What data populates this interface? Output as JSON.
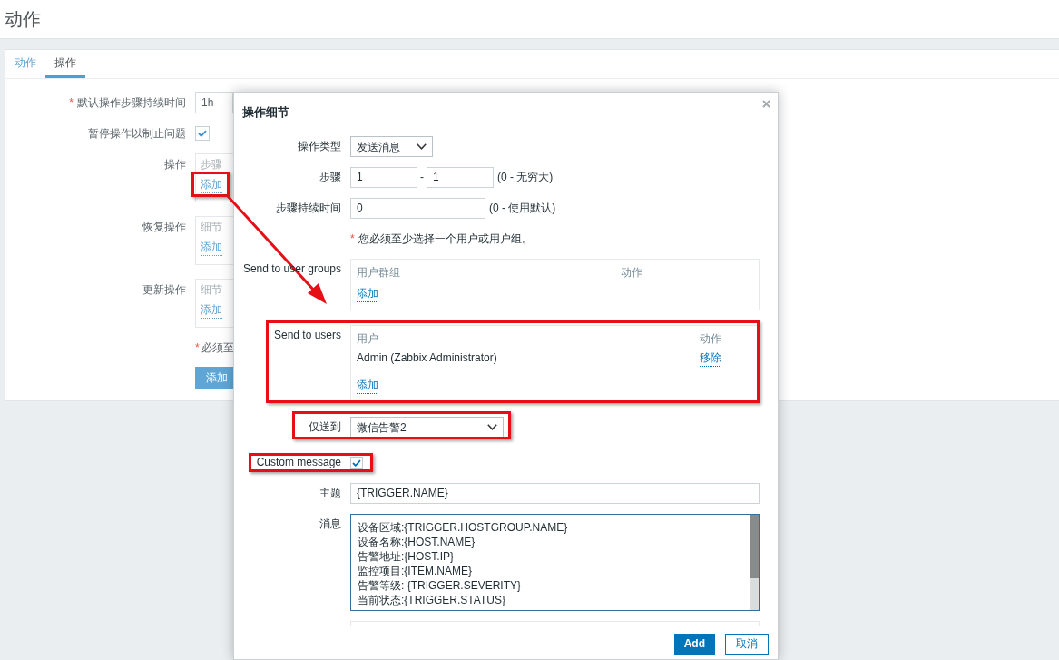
{
  "header": {
    "title": "动作"
  },
  "tabs": [
    {
      "label": "动作",
      "selected": false
    },
    {
      "label": "操作",
      "selected": true
    }
  ],
  "form": {
    "rows": [
      {
        "kind": "input",
        "mark": "*",
        "label": "默认操作步骤持续时间",
        "value": "1h",
        "highlighted": false
      },
      {
        "kind": "checkbox",
        "label": "暂停操作以制止问题",
        "checked": true,
        "highlighted": false
      },
      {
        "kind": "table",
        "label": "操作",
        "column": "步骤",
        "link": "添加",
        "highlighted": true
      },
      {
        "kind": "table",
        "label": "恢复操作",
        "column": "细节",
        "link": "添加",
        "highlighted": false
      },
      {
        "kind": "table",
        "label": "更新操作",
        "column": "细节",
        "link": "添加",
        "highlighted": false
      }
    ],
    "note": {
      "mark": "*",
      "text": "必须至"
    },
    "button": "添加"
  },
  "dialog": {
    "title": "操作细节",
    "fields": [
      {
        "kind": "select",
        "label": "操作类型",
        "value": "发送消息",
        "highlighted": false
      },
      {
        "kind": "range",
        "label": "步骤",
        "from": "1",
        "separator": "-",
        "to": "1",
        "hint": "(0 - 无穷大)",
        "highlighted": false
      },
      {
        "kind": "input",
        "label": "步骤持续时间",
        "value": "0",
        "hint": "(0 - 使用默认)",
        "highlighted": false
      },
      {
        "kind": "note",
        "mark": "*",
        "text": "您必须至少选择一个用户或用户组。",
        "highlighted": false
      },
      {
        "kind": "table",
        "label": "Send to user groups",
        "columns": [
          "用户群组",
          "动作"
        ],
        "link": "添加",
        "highlighted": false
      },
      {
        "kind": "table",
        "label": "Send to users",
        "columns": [
          "用户",
          "动作"
        ],
        "rows": [
          {
            "name": "Admin (Zabbix Administrator)",
            "action": "移除"
          }
        ],
        "link": "添加",
        "highlighted": true
      },
      {
        "kind": "select",
        "label": "仅送到",
        "value": "微信告警2",
        "highlighted": true
      },
      {
        "kind": "checkbox",
        "label": "Custom message",
        "checked": true,
        "highlighted": true
      },
      {
        "kind": "input",
        "label": "主题",
        "value": "{TRIGGER.NAME}",
        "highlighted": false
      },
      {
        "kind": "textarea",
        "label": "消息",
        "lines": [
          "设备区域:{TRIGGER.HOSTGROUP.NAME}",
          "设备名称:{HOST.NAME}",
          "告警地址:{HOST.IP}",
          "监控项目:{ITEM.NAME}",
          "告警等级: {TRIGGER.SEVERITY}",
          "当前状态:{TRIGGER.STATUS}"
        ],
        "highlighted": false
      },
      {
        "kind": "table_stub",
        "highlighted": false
      }
    ],
    "buttons": [
      {
        "label": "Add",
        "kind": "primary"
      },
      {
        "label": "取消",
        "kind": "secondary"
      }
    ]
  }
}
